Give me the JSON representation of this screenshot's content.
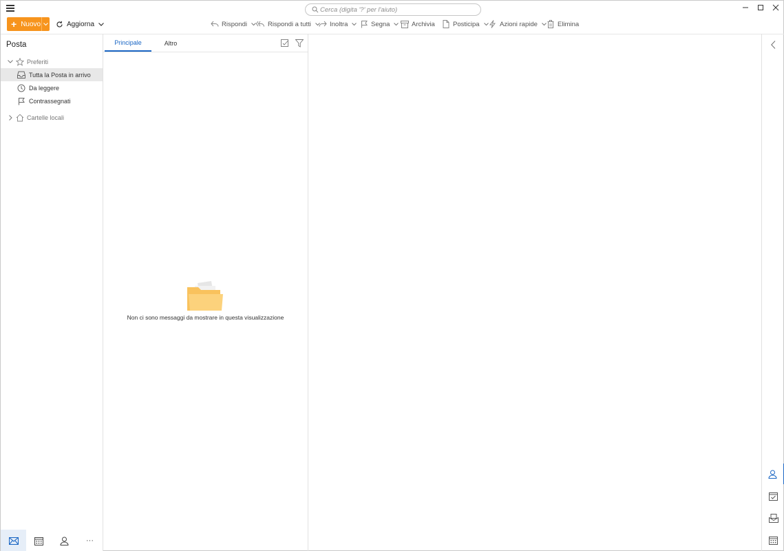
{
  "search": {
    "placeholder": "Cerca (digita '?' per l'aiuto)"
  },
  "toolbar": {
    "new_label": "Nuovo",
    "refresh_label": "Aggiorna",
    "actions": [
      {
        "label": "Rispondi",
        "icon": "reply-icon"
      },
      {
        "label": "Rispondi a tutti",
        "icon": "reply-all-icon"
      },
      {
        "label": "Inoltra",
        "icon": "forward-icon"
      },
      {
        "label": "Segna",
        "icon": "flag-icon"
      },
      {
        "label": "Archivia",
        "icon": "archive-icon"
      },
      {
        "label": "Posticipa",
        "icon": "snooze-icon"
      },
      {
        "label": "Azioni rapide",
        "icon": "bolt-icon"
      },
      {
        "label": "Elimina",
        "icon": "trash-icon"
      }
    ]
  },
  "sidebar": {
    "title": "Posta",
    "favorites_label": "Preferiti",
    "items": [
      {
        "label": "Tutta la Posta in arrivo",
        "icon": "inbox-icon",
        "selected": true
      },
      {
        "label": "Da leggere",
        "icon": "clock-icon"
      },
      {
        "label": "Contrassegnati",
        "icon": "flag-icon"
      }
    ],
    "local_folders_label": "Cartelle locali",
    "bottom_nav": [
      "mail-icon",
      "calendar-icon",
      "contacts-icon",
      "more-icon"
    ],
    "more_glyph": "···"
  },
  "message_list": {
    "tabs": [
      {
        "label": "Principale",
        "active": true
      },
      {
        "label": "Altro",
        "active": false
      }
    ],
    "empty_text": "Non ci sono messaggi da mostrare in questa visualizzazione"
  },
  "right_bar": [
    "collapse-icon",
    "contacts-icon",
    "tasks-icon",
    "mail-envelope-icon",
    "calendar-icon"
  ],
  "colors": {
    "accent": "#1a66c4",
    "new_button": "#f7941d",
    "selection": "#e8e8e8",
    "folder": "#fcd27c"
  }
}
